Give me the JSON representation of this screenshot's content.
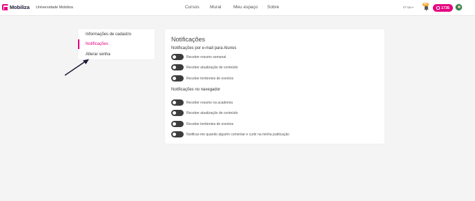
{
  "header": {
    "logo_text": "Mobiliza",
    "org_name": "Universidade Mobiliza",
    "nav": [
      "Cursos",
      "Mural",
      "Meu espaço",
      "Sobre"
    ],
    "language": "עברית",
    "notification_badge": "99+",
    "points": "1735"
  },
  "sidebar": {
    "items": [
      {
        "label": "Informações de cadastro",
        "active": false
      },
      {
        "label": "Notificações",
        "active": true
      },
      {
        "label": "Alterar senha",
        "active": false
      }
    ]
  },
  "main": {
    "title": "Notificações",
    "email_section": {
      "title": "Notificações por e-mail para Alunos",
      "toggles": [
        {
          "label": "Receber resumo semanal",
          "on": false
        },
        {
          "label": "Receber atualização de conteúdo",
          "on": false
        },
        {
          "label": "Receber lembretes de eventos",
          "on": false
        }
      ]
    },
    "browser_section": {
      "title": "Notificações no navegador",
      "toggles": [
        {
          "label": "Receber resumo na academia",
          "on": false
        },
        {
          "label": "Receber atualização de conteúdo",
          "on": false
        },
        {
          "label": "Receber lembretes de eventos",
          "on": false
        },
        {
          "label": "Notificar-me quando alguém comentar e curtir na minha publicação",
          "on": false
        }
      ]
    }
  },
  "colors": {
    "brand": "#e4007f",
    "toggle_off": "#3d3d3d",
    "badge": "#f5a623",
    "background": "#f4f4f5"
  },
  "icons": [
    "logo-icon",
    "bell-icon",
    "points-icon",
    "avatar",
    "caret-down-icon",
    "annotation-arrow"
  ]
}
